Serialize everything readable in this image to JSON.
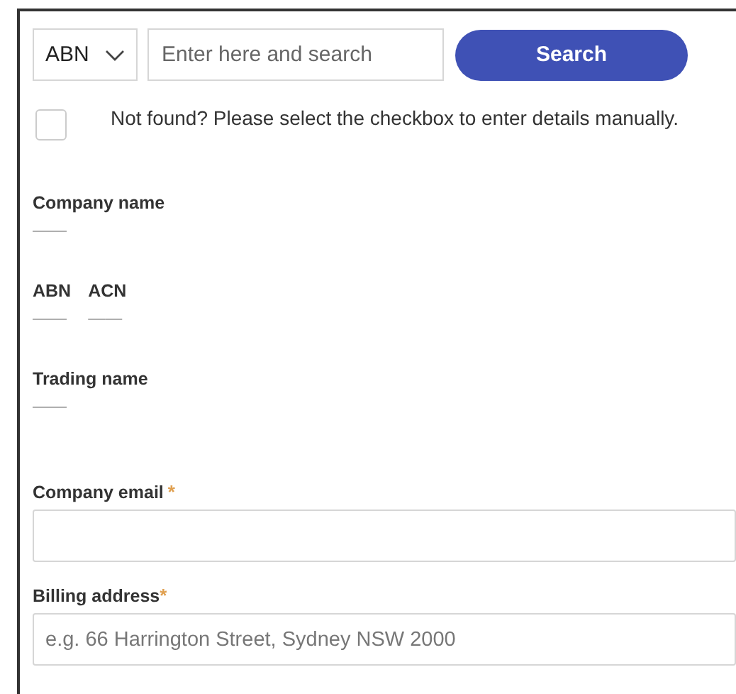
{
  "search": {
    "type_select": "ABN",
    "placeholder": "Enter here and search",
    "button": "Search"
  },
  "manual_entry": {
    "checked": false,
    "label": "Not found? Please select the checkbox to enter details manually."
  },
  "details": [
    {
      "label": "Company name",
      "value": "——"
    },
    {
      "label": "ABN",
      "value": "——"
    },
    {
      "label": "ACN",
      "value": "——"
    },
    {
      "label": "Trading name",
      "value": "——"
    }
  ],
  "fields": [
    {
      "label": "Company email",
      "required_mark": "*"
    },
    {
      "label": "Billing address",
      "required_mark": "*",
      "placeholder": "e.g. 66 Harrington Street, Sydney NSW 2000"
    }
  ]
}
